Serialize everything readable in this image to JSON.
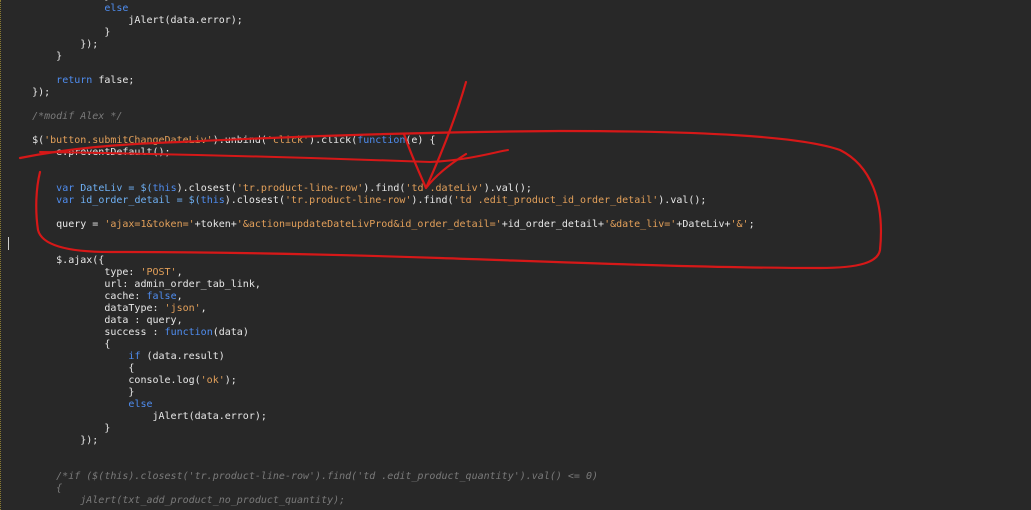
{
  "editor": {
    "lines": [
      [
        {
          "t": "                }",
          "c": "p"
        }
      ],
      [
        {
          "t": "                ",
          "c": "p"
        },
        {
          "t": "else",
          "c": "k"
        }
      ],
      [
        {
          "t": "                    jAlert(data.error);",
          "c": "p"
        }
      ],
      [
        {
          "t": "                }",
          "c": "p"
        }
      ],
      [
        {
          "t": "            });",
          "c": "p"
        }
      ],
      [
        {
          "t": "        }",
          "c": "p"
        }
      ],
      [
        {
          "t": "",
          "c": "p"
        }
      ],
      [
        {
          "t": "        ",
          "c": "p"
        },
        {
          "t": "return",
          "c": "k"
        },
        {
          "t": " false;",
          "c": "p"
        }
      ],
      [
        {
          "t": "    });",
          "c": "p"
        }
      ],
      [
        {
          "t": "",
          "c": "p"
        }
      ],
      [
        {
          "t": "    /*modif Alex */",
          "c": "c"
        }
      ],
      [
        {
          "t": "",
          "c": "p"
        }
      ],
      [
        {
          "t": "    $(",
          "c": "p"
        },
        {
          "t": "'button.submitChangeDateLiv'",
          "c": "s"
        },
        {
          "t": ").unbind(",
          "c": "p"
        },
        {
          "t": "'click'",
          "c": "s"
        },
        {
          "t": ").click(",
          "c": "p"
        },
        {
          "t": "function",
          "c": "k"
        },
        {
          "t": "(e) {",
          "c": "p"
        }
      ],
      [
        {
          "t": "        e.preventDefault();",
          "c": "p"
        }
      ],
      [
        {
          "t": "",
          "c": "p"
        }
      ],
      [
        {
          "t": "",
          "c": "p"
        }
      ],
      [
        {
          "t": "        ",
          "c": "p"
        },
        {
          "t": "var",
          "c": "k"
        },
        {
          "t": " DateLiv = $(",
          "c": "v"
        },
        {
          "t": "this",
          "c": "k"
        },
        {
          "t": ").closest(",
          "c": "p"
        },
        {
          "t": "'tr.product-line-row'",
          "c": "s"
        },
        {
          "t": ").find(",
          "c": "p"
        },
        {
          "t": "'td .dateLiv'",
          "c": "s"
        },
        {
          "t": ").val();",
          "c": "p"
        }
      ],
      [
        {
          "t": "        ",
          "c": "p"
        },
        {
          "t": "var",
          "c": "k"
        },
        {
          "t": " id_order_detail = $(",
          "c": "v"
        },
        {
          "t": "this",
          "c": "k"
        },
        {
          "t": ").closest(",
          "c": "p"
        },
        {
          "t": "'tr.product-line-row'",
          "c": "s"
        },
        {
          "t": ").find(",
          "c": "p"
        },
        {
          "t": "'td .edit_product_id_order_detail'",
          "c": "s"
        },
        {
          "t": ").val();",
          "c": "p"
        }
      ],
      [
        {
          "t": "",
          "c": "p"
        }
      ],
      [
        {
          "t": "        query = ",
          "c": "p"
        },
        {
          "t": "'ajax=1&token='",
          "c": "s"
        },
        {
          "t": "+token+",
          "c": "p"
        },
        {
          "t": "'&action=updateDateLivProd&id_order_detail='",
          "c": "s"
        },
        {
          "t": "+id_order_detail+",
          "c": "p"
        },
        {
          "t": "'&date_liv='",
          "c": "s"
        },
        {
          "t": "+DateLiv+",
          "c": "p"
        },
        {
          "t": "'&'",
          "c": "s"
        },
        {
          "t": ";",
          "c": "p"
        }
      ],
      [
        {
          "t": "",
          "c": "p"
        }
      ],
      [
        {
          "t": "",
          "c": "p"
        }
      ],
      [
        {
          "t": "        $.ajax({",
          "c": "p"
        }
      ],
      [
        {
          "t": "                type: ",
          "c": "p"
        },
        {
          "t": "'POST'",
          "c": "s"
        },
        {
          "t": ",",
          "c": "p"
        }
      ],
      [
        {
          "t": "                url: admin_order_tab_link,",
          "c": "p"
        }
      ],
      [
        {
          "t": "                cache: ",
          "c": "p"
        },
        {
          "t": "false",
          "c": "k"
        },
        {
          "t": ",",
          "c": "p"
        }
      ],
      [
        {
          "t": "                dataType: ",
          "c": "p"
        },
        {
          "t": "'json'",
          "c": "s"
        },
        {
          "t": ",",
          "c": "p"
        }
      ],
      [
        {
          "t": "                data : query,",
          "c": "p"
        }
      ],
      [
        {
          "t": "                success : ",
          "c": "p"
        },
        {
          "t": "function",
          "c": "k"
        },
        {
          "t": "(data)",
          "c": "p"
        }
      ],
      [
        {
          "t": "                {",
          "c": "p"
        }
      ],
      [
        {
          "t": "                    ",
          "c": "p"
        },
        {
          "t": "if",
          "c": "k"
        },
        {
          "t": " (data.result)",
          "c": "p"
        }
      ],
      [
        {
          "t": "                    {",
          "c": "p"
        }
      ],
      [
        {
          "t": "                    console.log(",
          "c": "p"
        },
        {
          "t": "'ok'",
          "c": "s"
        },
        {
          "t": ");",
          "c": "p"
        }
      ],
      [
        {
          "t": "                    }",
          "c": "p"
        }
      ],
      [
        {
          "t": "                    ",
          "c": "p"
        },
        {
          "t": "else",
          "c": "k"
        }
      ],
      [
        {
          "t": "                        jAlert(data.error);",
          "c": "p"
        }
      ],
      [
        {
          "t": "                }",
          "c": "p"
        }
      ],
      [
        {
          "t": "            });",
          "c": "p"
        }
      ],
      [
        {
          "t": "",
          "c": "p"
        }
      ],
      [
        {
          "t": "",
          "c": "p"
        }
      ],
      [
        {
          "t": "        /*if ($(this).closest('tr.product-line-row').find('td .edit_product_quantity').val() <= 0)",
          "c": "c"
        }
      ],
      [
        {
          "t": "        {",
          "c": "c"
        }
      ],
      [
        {
          "t": "            jAlert(txt_add_product_no_product_quantity);",
          "c": "c"
        }
      ]
    ]
  },
  "annotation": {
    "color": "#d61818"
  }
}
